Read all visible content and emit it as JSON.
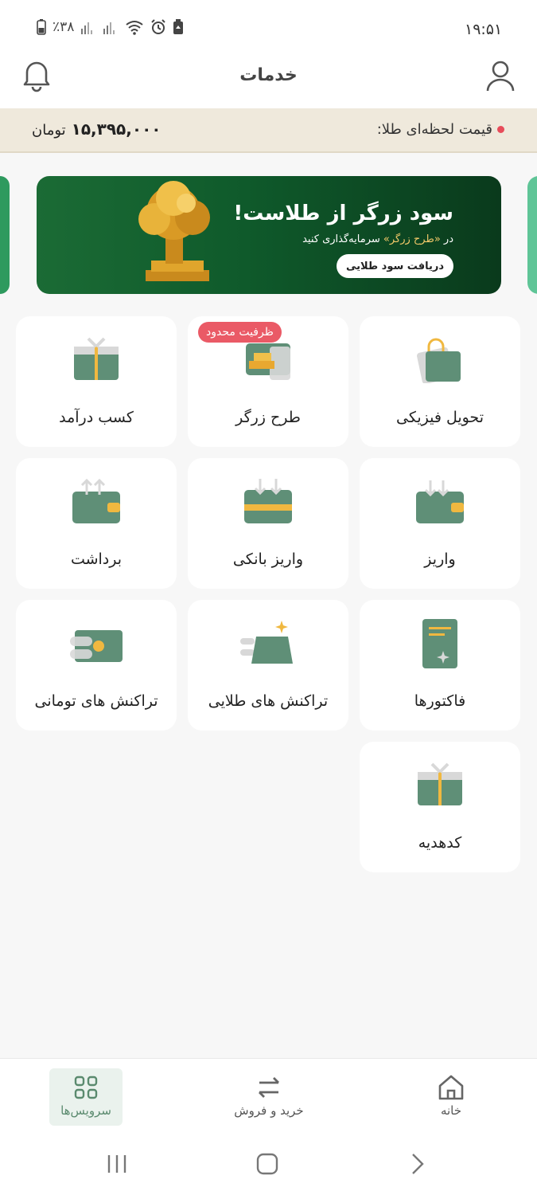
{
  "status_bar": {
    "time": "۱۹:۵۱",
    "battery_pct": "٪۳۸"
  },
  "header": {
    "title": "خدمات"
  },
  "gold_price": {
    "label": "قیمت لحظه‌ای طلا:",
    "value": "۱۵,۳۹۵,۰۰۰",
    "unit": "تومان"
  },
  "banner": {
    "title": "سود زرگر از طلاست!",
    "sub_prefix": "در",
    "sub_highlight": "«طرح زرگر»",
    "sub_suffix": "سرمایه‌گذاری کنید",
    "button": "دریافت سود طلایی"
  },
  "services": [
    {
      "label": "تحویل فیزیکی",
      "icon": "shopping-bag-icon"
    },
    {
      "label": "طرح زرگر",
      "icon": "gold-bars-icon",
      "badge": "ظرفیت محدود"
    },
    {
      "label": "کسب درآمد",
      "icon": "gift-box-icon"
    },
    {
      "label": "واریز",
      "icon": "wallet-deposit-icon"
    },
    {
      "label": "واریز بانکی",
      "icon": "bank-card-deposit-icon"
    },
    {
      "label": "برداشت",
      "icon": "wallet-withdraw-icon"
    },
    {
      "label": "فاکتورها",
      "icon": "invoice-icon"
    },
    {
      "label": "تراکنش های طلایی",
      "icon": "gold-transactions-icon"
    },
    {
      "label": "تراکنش های تومانی",
      "icon": "cash-transactions-icon"
    },
    {
      "label": "کدهدیه",
      "icon": "gift-code-icon"
    }
  ],
  "bottom_nav": [
    {
      "label": "خانه",
      "icon": "home-icon",
      "active": false
    },
    {
      "label": "خرید و فروش",
      "icon": "swap-arrows-icon",
      "active": false
    },
    {
      "label": "سرویس‌ها",
      "icon": "grid-icon",
      "active": true
    }
  ],
  "colors": {
    "accent_green": "#5f8f77",
    "gold": "#f0b840",
    "badge_red": "#ea5a66",
    "price_bar_bg": "#efe9dc"
  }
}
